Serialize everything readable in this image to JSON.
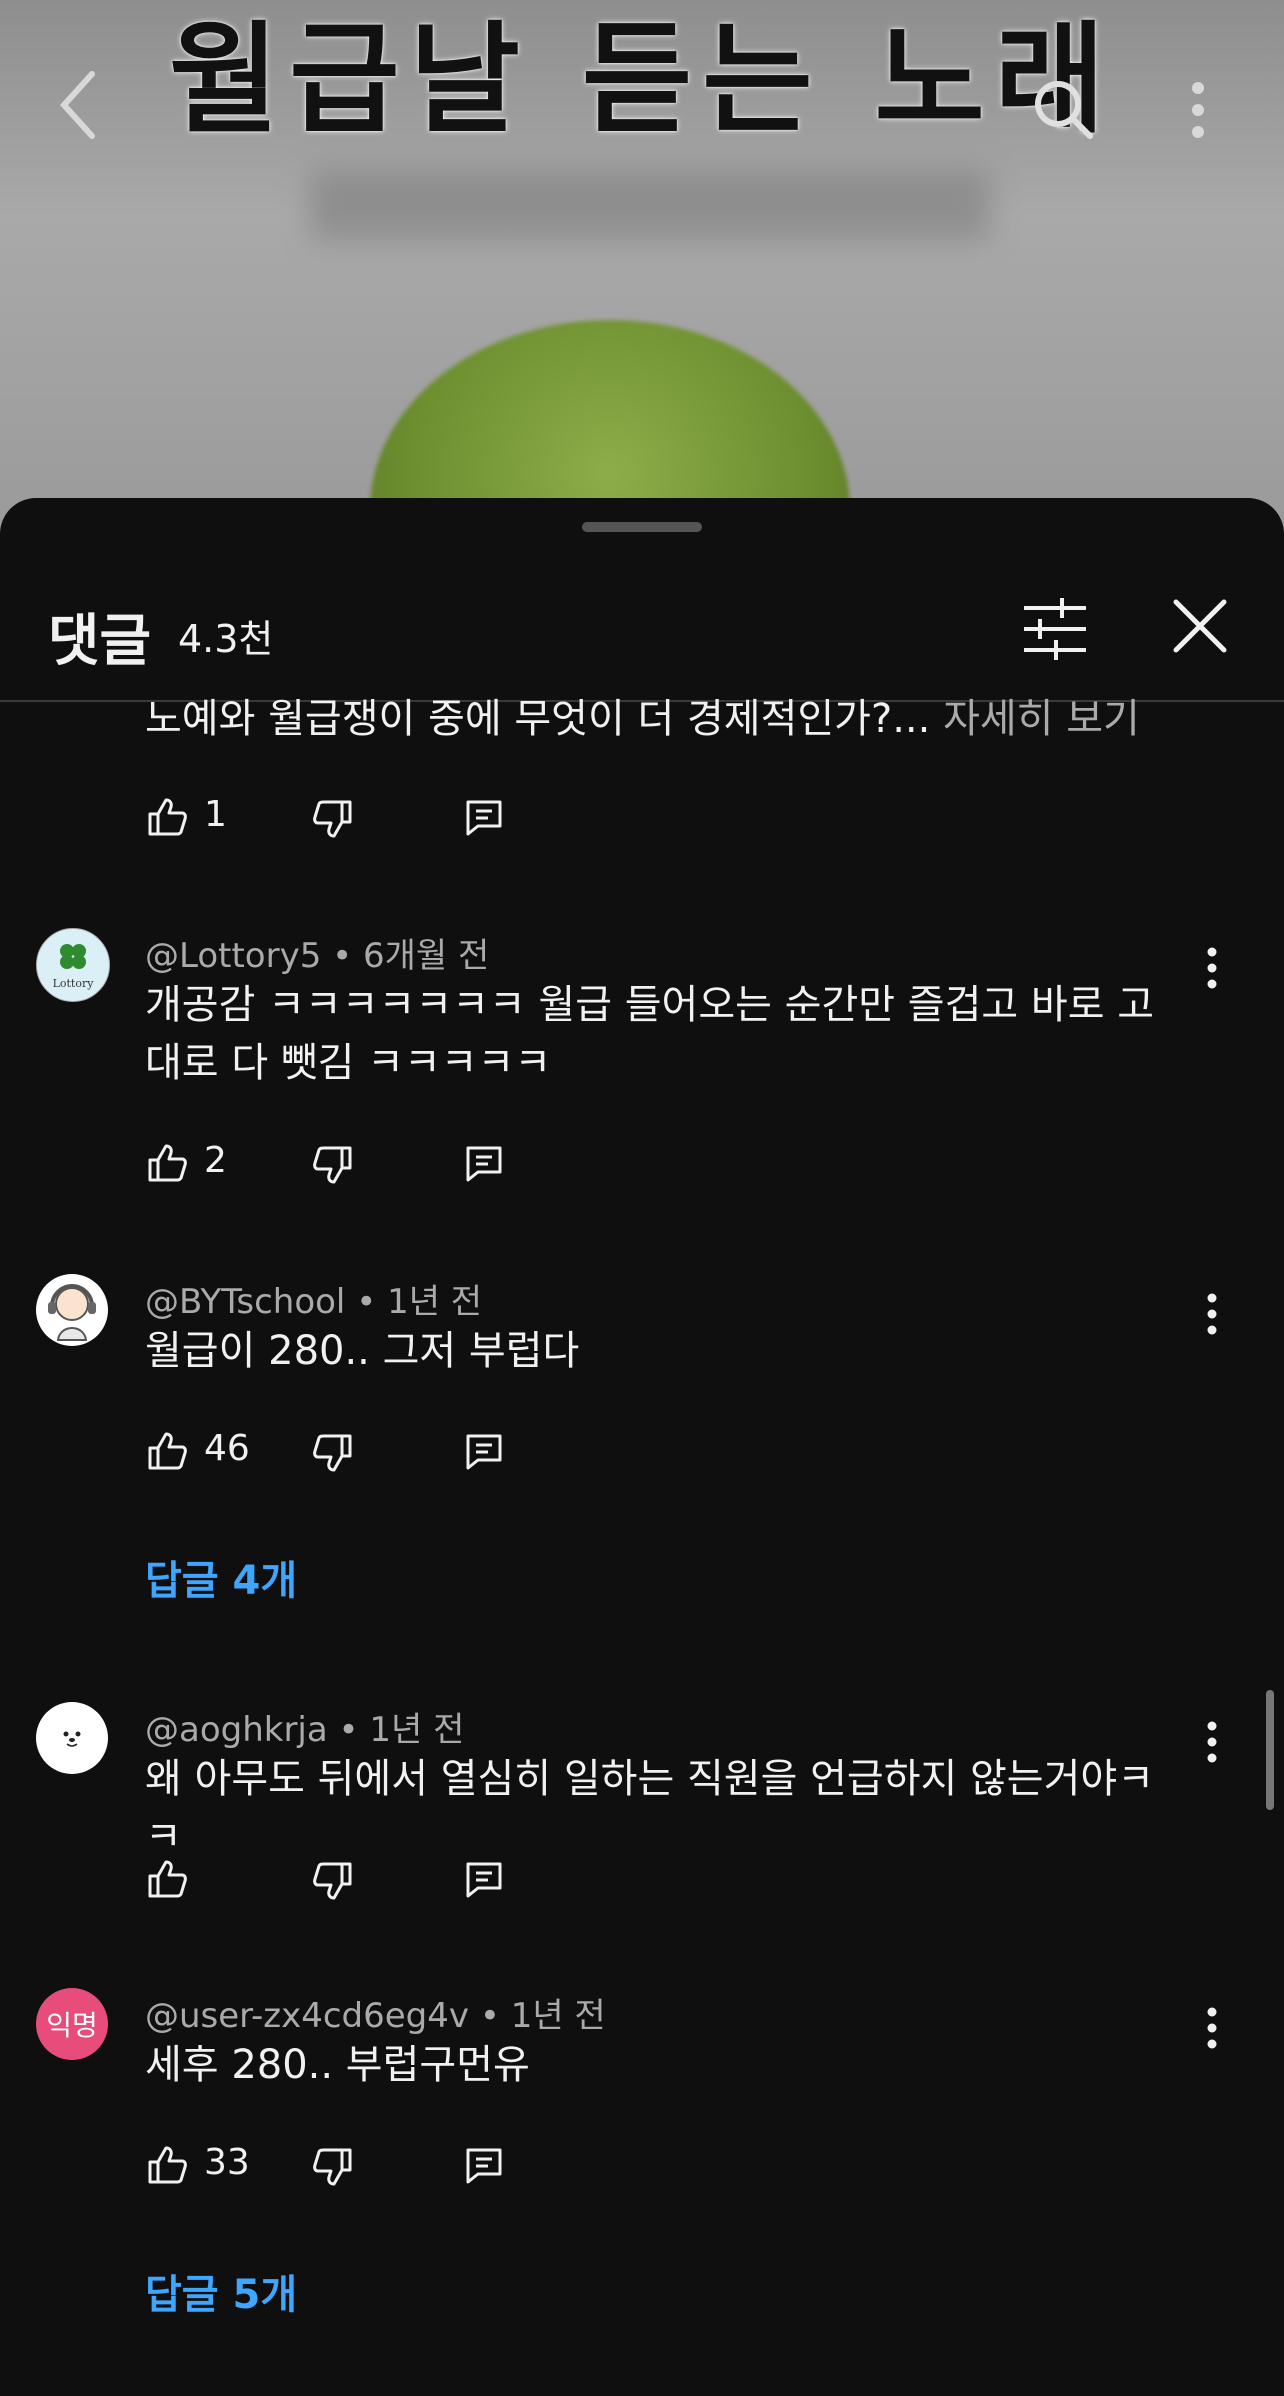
{
  "video": {
    "title_overlay": "월급날 듣는 노래"
  },
  "sheet": {
    "title": "댓글",
    "count": "4.3천"
  },
  "truncated_comment": {
    "text": "노예와 월급쟁이 중에 무엇이 더 경제적인가?...",
    "see_more": "자세히 보기",
    "likes": "1"
  },
  "comments": [
    {
      "author": "@Lottory5",
      "time": "6개월 전",
      "text": "개공감 ㅋㅋㅋㅋㅋㅋㅋ 월급 들어오는 순간만 즐겁고 바로 고대로 다 뺏김 ㅋㅋㅋㅋㅋ",
      "likes": "2",
      "avatar_label": "Lottory"
    },
    {
      "author": "@BYTschool",
      "time": "1년 전",
      "text": "월급이 280.. 그저 부럽다",
      "likes": "46",
      "replies": "답글 4개"
    },
    {
      "author": "@aoghkrja",
      "time": "1년 전",
      "text": "왜 아무도 뒤에서 열심히 일하는 직원을 언급하지 않는거야ㅋㅋ",
      "likes": ""
    },
    {
      "author": "@user-zx4cd6eg4v",
      "time": "1년 전",
      "text": "세후 280.. 부럽구먼유",
      "likes": "33",
      "replies": "답글 5개",
      "avatar_label": "익명"
    }
  ],
  "colors": {
    "background": "#0f0f0f",
    "link": "#3ea6ff",
    "secondary_text": "#aaaaaa",
    "anon_avatar": "#e84c7a"
  }
}
